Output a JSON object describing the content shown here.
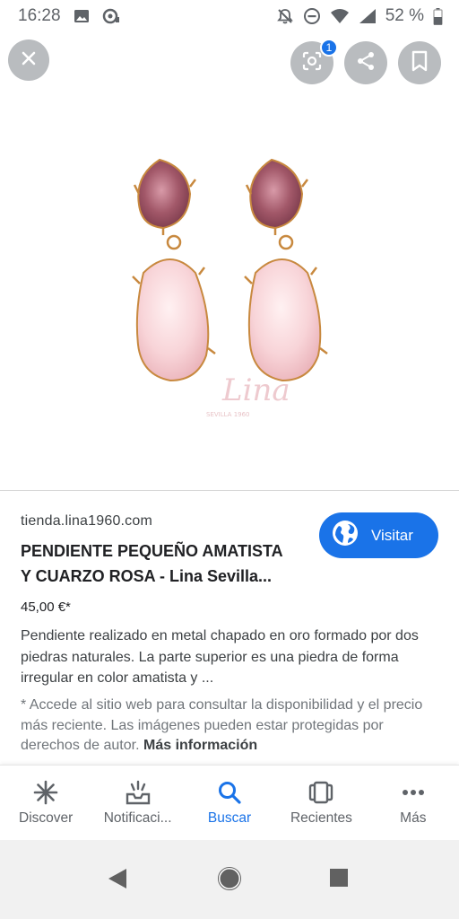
{
  "status_bar": {
    "time": "16:28",
    "battery_percent": "52 %",
    "icons": [
      "image-icon",
      "assistant-icon",
      "mute-icon",
      "dnd-icon",
      "wifi-icon",
      "signal-icon",
      "battery-icon"
    ]
  },
  "viewer": {
    "close_icon": "close-icon",
    "lens_icon": "lens-icon",
    "lens_badge": "1",
    "share_icon": "share-icon",
    "save_icon": "bookmark-icon",
    "watermark_text": "Lina",
    "watermark_sub": "SEVILLA 1960"
  },
  "result": {
    "domain": "tienda.lina1960.com",
    "title_line1": "PENDIENTE PEQUEÑO AMATISTA",
    "title_line2": "Y CUARZO ROSA - Lina Sevilla...",
    "visit_label": "Visitar",
    "visit_icon": "globe-icon",
    "price": "45,00 €*",
    "description": "Pendiente realizado en metal chapado en oro formado por dos piedras naturales. La parte superior es una piedra de forma irregular en color amatista y ...",
    "disclaimer": "* Accede al sitio web para consultar la disponibilidad y el precio más reciente. Las imágenes pueden estar protegidas por derechos de autor.",
    "more_info": "Más información"
  },
  "bottom_nav": {
    "items": [
      {
        "label": "Discover",
        "icon": "asterisk-icon",
        "active": false
      },
      {
        "label": "Notificaci...",
        "icon": "updates-icon",
        "active": false
      },
      {
        "label": "Buscar",
        "icon": "search-icon",
        "active": true
      },
      {
        "label": "Recientes",
        "icon": "recents-icon",
        "active": false
      },
      {
        "label": "Más",
        "icon": "more-icon",
        "active": false
      }
    ]
  },
  "colors": {
    "accent": "#1a73e8",
    "amethyst": "#a35a6d",
    "rose_quartz": "#f6cfd3",
    "gold": "#c8893f"
  }
}
